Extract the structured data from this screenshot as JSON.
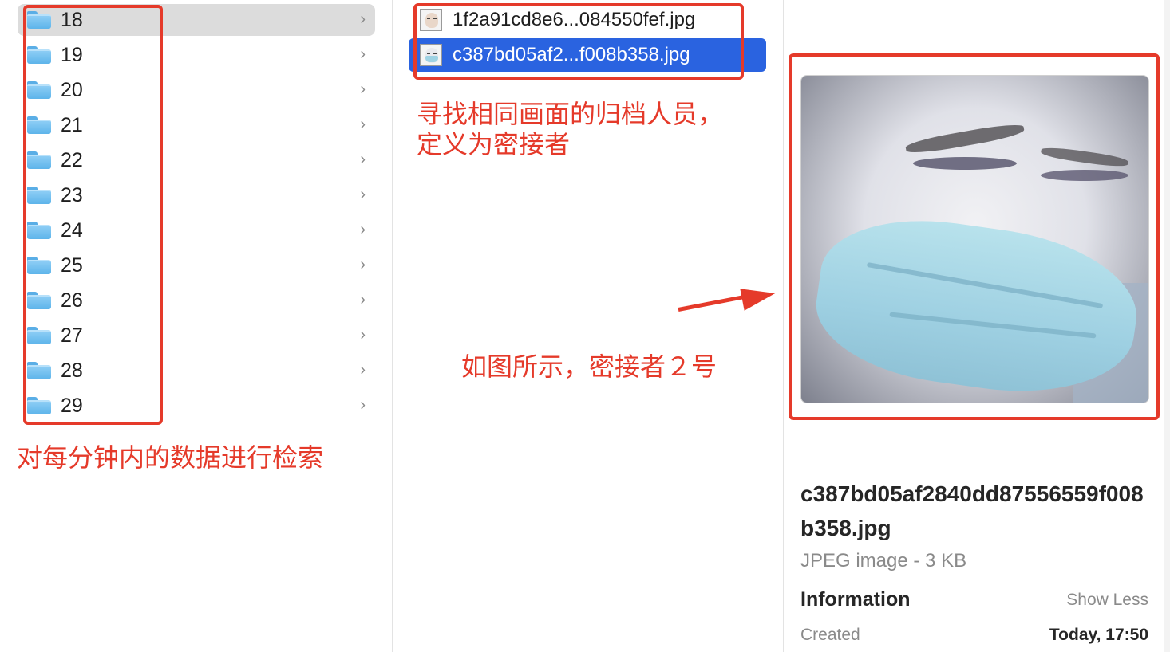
{
  "folders": [
    {
      "name": "18",
      "selected": true
    },
    {
      "name": "19",
      "selected": false
    },
    {
      "name": "20",
      "selected": false
    },
    {
      "name": "21",
      "selected": false
    },
    {
      "name": "22",
      "selected": false
    },
    {
      "name": "23",
      "selected": false
    },
    {
      "name": "24",
      "selected": false
    },
    {
      "name": "25",
      "selected": false
    },
    {
      "name": "26",
      "selected": false
    },
    {
      "name": "27",
      "selected": false
    },
    {
      "name": "28",
      "selected": false
    },
    {
      "name": "29",
      "selected": false
    }
  ],
  "files": [
    {
      "name": "1f2a91cd8e6...084550fef.jpg",
      "selected": false,
      "thumb": "face-photo"
    },
    {
      "name": "c387bd05af2...f008b358.jpg",
      "selected": true,
      "thumb": "masked-face-photo"
    }
  ],
  "preview": {
    "title": "c387bd05af2840dd87556559f008b358.jpg",
    "kind": "JPEG image - 3 KB",
    "info_heading": "Information",
    "show_less": "Show Less",
    "created_label": "Created",
    "created_value": "Today, 17:50"
  },
  "annotations": {
    "folders_note": "对每分钟内的数据进行检索",
    "files_note_line1": "寻找相同画面的归档人员，",
    "files_note_line2": "定义为密接者",
    "preview_note": "如图所示，密接者２号"
  },
  "colors": {
    "annotation_red": "#e53a2a",
    "selection_blue": "#2a63e0",
    "folder_blue": "#5db4ea"
  },
  "icons": {
    "folder": "folder-icon",
    "chevron": "chevron-right-icon"
  }
}
